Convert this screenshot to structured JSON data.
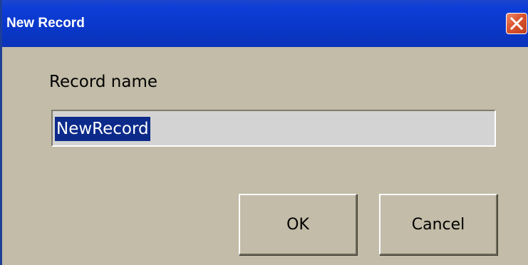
{
  "window": {
    "title": "New Record",
    "close_icon": "close-icon"
  },
  "form": {
    "label": "Record name",
    "input_value": "NewRecord",
    "input_selected": true
  },
  "buttons": {
    "ok_label": "OK",
    "cancel_label": "Cancel"
  },
  "colors": {
    "title_bar": "#0a37c9",
    "dialog_background": "#c2bca8",
    "selection_highlight": "#0c2a8a",
    "close_button": "#d9532e"
  }
}
